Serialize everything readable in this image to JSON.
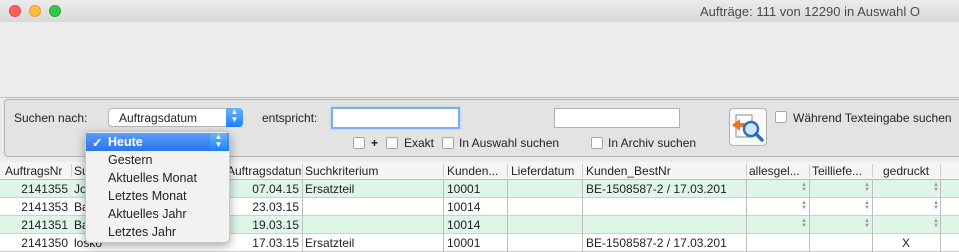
{
  "window": {
    "title": "Aufträge: 111 von 12290 in Auswahl O"
  },
  "search": {
    "label": "Suchen nach:",
    "field_value": "Auftragsdatum",
    "match_label": "entspricht:",
    "match_value": "",
    "second_value": "",
    "plus": "+",
    "exakt": "Exakt",
    "in_auswahl": "In Auswahl suchen",
    "in_archiv": "In Archiv suchen",
    "live_search": "Während Texteingabe suchen"
  },
  "menu": {
    "selected_index": 0,
    "items": [
      "Heute",
      "Gestern",
      "Aktuelles Monat",
      "Letztes Monat",
      "Aktuelles Jahr",
      "Letztes Jahr"
    ]
  },
  "table": {
    "columns": [
      "AuftragsNr",
      "Su",
      "Auftragsdatum",
      "Suchkriterium",
      "Kunden...",
      "Lieferdatum",
      "Kunden_BestNr",
      "allesgel...",
      "Teilliefe...",
      "gedruckt"
    ],
    "rows": [
      {
        "nr": "2141355",
        "su": "Jo",
        "datum": "07.04.15",
        "krit": "Ersatzteil",
        "kunde": "10001",
        "liefer": "",
        "best": "BE-1508587-2 / 17.03.201",
        "gedruckt": ""
      },
      {
        "nr": "2141353",
        "su": "Ba",
        "datum": "23.03.15",
        "krit": "",
        "kunde": "10014",
        "liefer": "",
        "best": "",
        "gedruckt": ""
      },
      {
        "nr": "2141351",
        "su": "Ba",
        "datum": "19.03.15",
        "krit": "",
        "kunde": "10014",
        "liefer": "",
        "best": "",
        "gedruckt": ""
      },
      {
        "nr": "2141350",
        "su": "losko",
        "datum": "17.03.15",
        "krit": "Ersatzteil",
        "kunde": "10001",
        "liefer": "",
        "best": "BE-1508587-2 / 17.03.201",
        "gedruckt": "X"
      }
    ]
  }
}
